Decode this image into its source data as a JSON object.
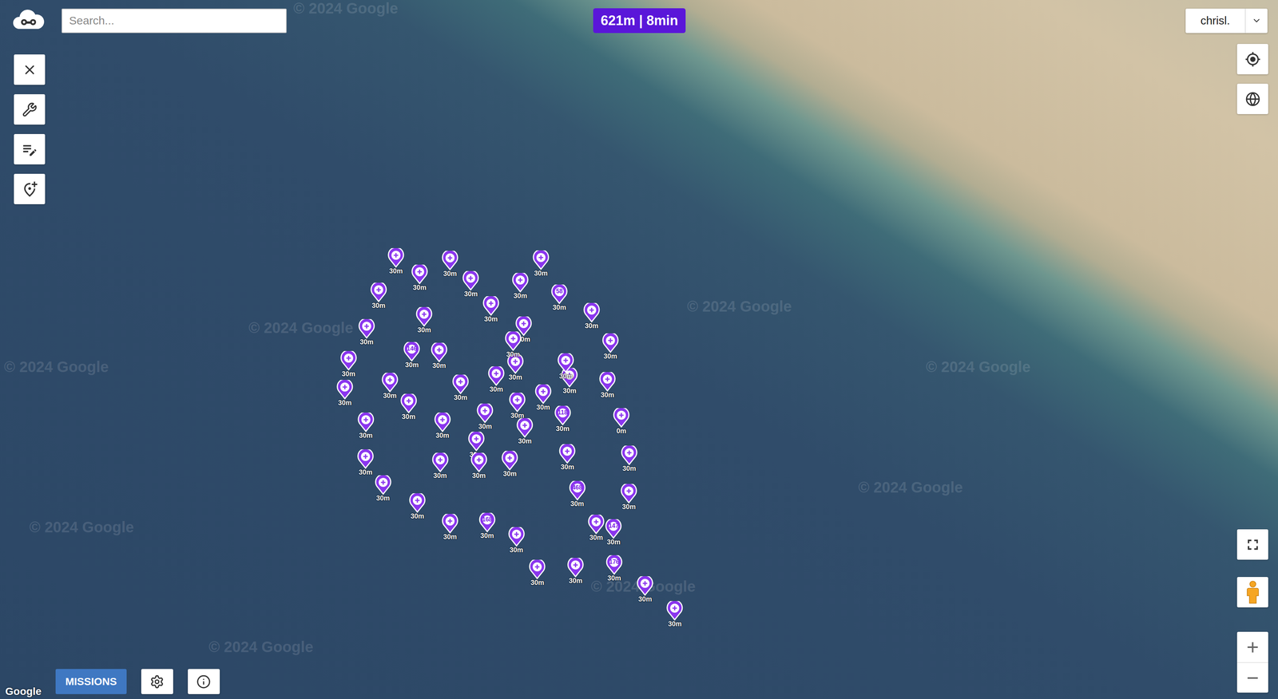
{
  "search": {
    "placeholder": "Search..."
  },
  "route_summary": "621m | 8min",
  "user_menu": {
    "label": "chrisl."
  },
  "map": {
    "attribution": "Google",
    "watermarks": [
      "© 2024 Google",
      "© 2024 Google",
      "© 2024 Google",
      "© 2024 Google",
      "© 2024 Google",
      "© 2024 Google",
      "© 2024 Google",
      "© 2024 Google",
      "© 2024 Google"
    ]
  },
  "zoom": {
    "in": "+",
    "out": "−"
  },
  "bottom_bar": {
    "missions_button": "MISSIONS"
  },
  "waypoints": [
    {
      "number": "",
      "altitude": "30m"
    },
    {
      "number": "",
      "altitude": "30m"
    },
    {
      "number": "176",
      "altitude": "30m"
    },
    {
      "number": "",
      "altitude": "30m"
    },
    {
      "number": "",
      "altitude": "30m"
    },
    {
      "number": "",
      "altitude": "30m"
    },
    {
      "number": "168",
      "altitude": "30m"
    },
    {
      "number": "",
      "altitude": "30m"
    },
    {
      "number": "",
      "altitude": "30m"
    },
    {
      "number": "",
      "altitude": "30m"
    },
    {
      "number": "",
      "altitude": "30m"
    },
    {
      "number": "",
      "altitude": "30m"
    },
    {
      "number": "",
      "altitude": "30m"
    },
    {
      "number": "",
      "altitude": "30m"
    },
    {
      "number": "",
      "altitude": "30m"
    },
    {
      "number": "",
      "altitude": "30m"
    },
    {
      "number": "",
      "altitude": "30m"
    },
    {
      "number": "",
      "altitude": "30m"
    },
    {
      "number": "",
      "altitude": "30m"
    },
    {
      "number": "",
      "altitude": "30m"
    },
    {
      "number": "",
      "altitude": "30m"
    },
    {
      "number": "",
      "altitude": "30m"
    },
    {
      "number": "",
      "altitude": "30m"
    },
    {
      "number": "58",
      "altitude": "30m"
    },
    {
      "number": "",
      "altitude": "30m"
    },
    {
      "number": "",
      "altitude": "30m"
    },
    {
      "number": "",
      "altitude": "30m"
    },
    {
      "number": "",
      "altitude": "0m"
    },
    {
      "number": "",
      "altitude": "30m"
    },
    {
      "number": "",
      "altitude": "30m"
    },
    {
      "number": "147",
      "altitude": "30m"
    },
    {
      "number": "",
      "altitude": "30m"
    },
    {
      "number": "468",
      "altitude": "30m"
    },
    {
      "number": "",
      "altitude": "30m"
    },
    {
      "number": "118",
      "altitude": "30m"
    },
    {
      "number": "",
      "altitude": "30m"
    },
    {
      "number": "",
      "altitude": "30m"
    },
    {
      "number": "",
      "altitude": "30m"
    },
    {
      "number": "",
      "altitude": "30m"
    },
    {
      "number": "",
      "altitude": "30m"
    },
    {
      "number": "",
      "altitude": "30m"
    },
    {
      "number": "",
      "altitude": "30m"
    },
    {
      "number": "",
      "altitude": "30m"
    },
    {
      "number": "",
      "altitude": "30m"
    },
    {
      "number": "",
      "altitude": "30m"
    },
    {
      "number": "",
      "altitude": "30m"
    },
    {
      "number": "",
      "altitude": "30m"
    },
    {
      "number": "",
      "altitude": "30m"
    },
    {
      "number": "146",
      "altitude": "30m"
    },
    {
      "number": "",
      "altitude": "30m"
    },
    {
      "number": "",
      "altitude": "30m"
    },
    {
      "number": "",
      "altitude": "30m"
    },
    {
      "number": "",
      "altitude": "30m"
    },
    {
      "number": "",
      "altitude": "30m"
    },
    {
      "number": "",
      "altitude": "30m"
    },
    {
      "number": "",
      "altitude": "30m"
    }
  ]
}
